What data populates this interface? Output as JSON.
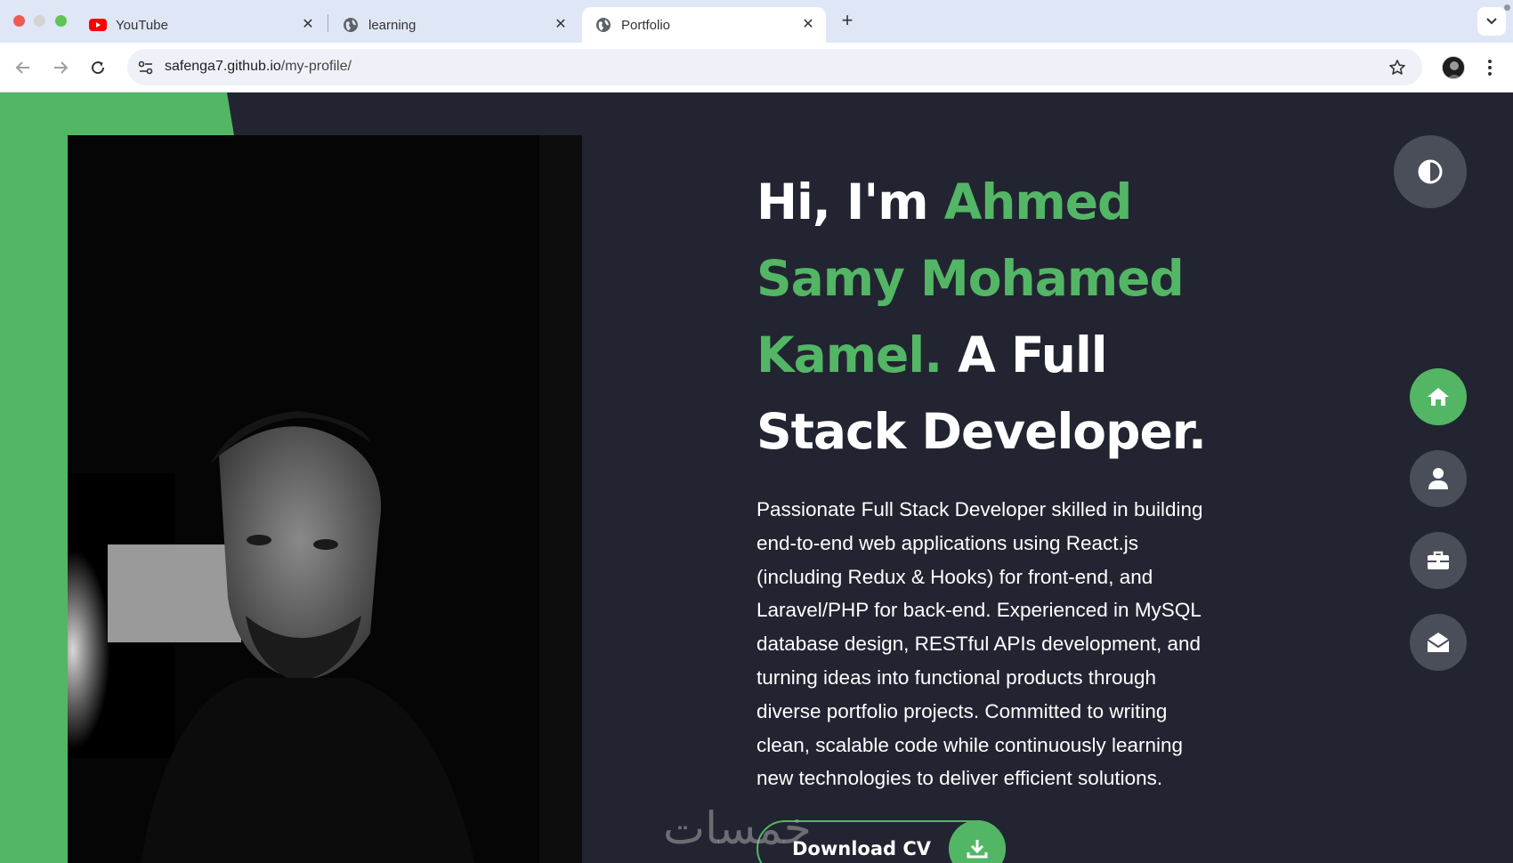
{
  "browser": {
    "tabs": [
      {
        "title": "YouTube",
        "icon": "youtube-icon",
        "active": false
      },
      {
        "title": "learning",
        "icon": "globe-icon",
        "active": false
      },
      {
        "title": "Portfolio",
        "icon": "globe-icon",
        "active": true
      }
    ],
    "url_domain": "safenga7.github.io",
    "url_path": "/my-profile/"
  },
  "hero": {
    "greeting": "Hi, I'm ",
    "name": "Ahmed Samy Mohamed Kamel.",
    "role": " A Full Stack Developer.",
    "description": "Passionate Full Stack Developer skilled in building end-to-end web applications using React.js (including Redux & Hooks) for front-end, and Laravel/PHP for back-end. Experienced in MySQL database design, RESTful APIs development, and turning ideas into functional products through diverse portfolio projects. Committed to writing clean, scalable code while continuously learning new technologies to deliver efficient solutions.",
    "cv_button": "Download CV"
  },
  "watermark": "خمسات",
  "side_nav": [
    {
      "name": "home",
      "icon": "home-icon",
      "active": true
    },
    {
      "name": "about",
      "icon": "user-icon",
      "active": false
    },
    {
      "name": "portfolio",
      "icon": "briefcase-icon",
      "active": false
    },
    {
      "name": "contact",
      "icon": "envelope-open-icon",
      "active": false
    }
  ],
  "colors": {
    "accent": "#53b665",
    "background": "#222531",
    "nav_button": "#4a4e58",
    "chrome_tabbar": "#dfe7f7"
  }
}
